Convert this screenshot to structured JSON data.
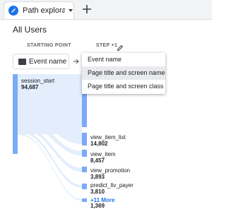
{
  "tab": {
    "title": "Path exploratio",
    "icon": "path-exploration-icon"
  },
  "segment": "All Users",
  "headers": {
    "starting_point": "STARTING POINT",
    "step": "STEP +1"
  },
  "start_chip": {
    "label": "Event name"
  },
  "menu": {
    "items": [
      "Event name",
      "Page title and screen name",
      "Page title and screen class"
    ],
    "selected": "Page title and screen name"
  },
  "start_node": {
    "label": "session_start",
    "value": "94,687"
  },
  "step_nodes": [
    {
      "label": "view_item_list",
      "value": "14,802"
    },
    {
      "label": "view_item",
      "value": "8,457"
    },
    {
      "label": "view_promotion",
      "value": "3,893"
    },
    {
      "label": "predict_ltv_payer",
      "value": "3,810"
    }
  ],
  "more": {
    "label": "+11 More",
    "value": "1,369"
  },
  "colors": {
    "accent": "#1a73e8",
    "bar": "#7baaf7",
    "flow": "#e3edfc"
  }
}
